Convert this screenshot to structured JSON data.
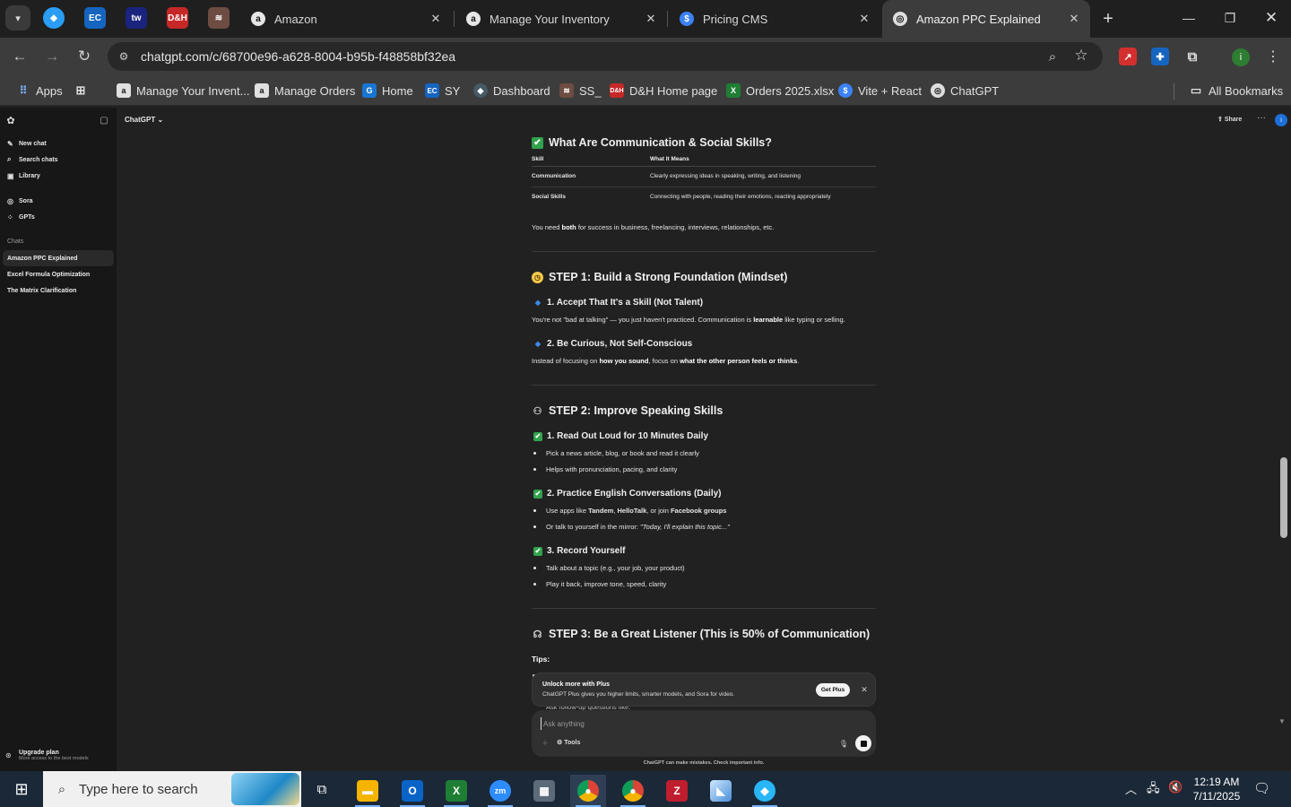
{
  "browser": {
    "tabs": [
      {
        "title": "Amazon",
        "favicon": "a"
      },
      {
        "title": "Manage Your Inventory",
        "favicon": "a"
      },
      {
        "title": "Pricing CMS",
        "favicon": "$"
      },
      {
        "title": "Amazon PPC Explained",
        "favicon": "◎"
      }
    ],
    "url": "chatgpt.com/c/68700e96-a628-8004-b95b-f48858bf32ea",
    "profile_initial": "i",
    "bookmarks": {
      "apps": "Apps",
      "items": [
        "Manage Your Invent...",
        "Manage Orders",
        "Home",
        "SY",
        "Dashboard",
        "SS_",
        "D&H Home page",
        "Orders 2025.xlsx",
        "Vite + React",
        "ChatGPT"
      ],
      "all": "All Bookmarks"
    }
  },
  "sidebar": {
    "new_chat": "New chat",
    "search_chats": "Search chats",
    "library": "Library",
    "sora": "Sora",
    "gpts": "GPTs",
    "chats_label": "Chats",
    "chats": [
      "Amazon PPC Explained",
      "Excel Formula Optimization",
      "The Matrix Clarification"
    ],
    "upgrade_title": "Upgrade plan",
    "upgrade_sub": "More access to the best models"
  },
  "header": {
    "model": "ChatGPT",
    "share": "Share",
    "avatar": "i"
  },
  "content": {
    "h_comm": "What Are Communication & Social Skills?",
    "table": {
      "headers": [
        "Skill",
        "What It Means"
      ],
      "rows": [
        [
          "Communication",
          "Clearly expressing ideas in speaking, writing, and listening"
        ],
        [
          "Social Skills",
          "Connecting with people, reading their emotions, reacting appropriately"
        ]
      ]
    },
    "need_both_pre": "You need ",
    "need_both_bold": "both",
    "need_both_post": " for success in business, freelancing, interviews, relationships, etc.",
    "step1": "STEP 1: Build a Strong Foundation (Mindset)",
    "s1_1": "1. Accept That It's a Skill (Not Talent)",
    "s1_1_pre": "You're not \"bad at talking\" — you just haven't practiced. Communication is ",
    "s1_1_bold": "learnable",
    "s1_1_post": " like typing or selling.",
    "s1_2": "2. Be Curious, Not Self-Conscious",
    "s1_2_pre": "Instead of focusing on ",
    "s1_2_bold1": "how you sound",
    "s1_2_mid": ", focus on ",
    "s1_2_bold2": "what the other person feels or thinks",
    "s1_2_post": ".",
    "step2": "STEP 2: Improve Speaking Skills",
    "s2_1": "1. Read Out Loud for 10 Minutes Daily",
    "s2_1_b1": "Pick a news article, blog, or book and read it clearly",
    "s2_1_b2": "Helps with pronunciation, pacing, and clarity",
    "s2_2": "2. Practice English Conversations (Daily)",
    "s2_2_b1_pre": "Use apps like ",
    "s2_2_b1_bold1": "Tandem",
    "s2_2_b1_sep": ", ",
    "s2_2_b1_bold2": "HelloTalk",
    "s2_2_b1_mid": ", or join ",
    "s2_2_b1_bold3": "Facebook groups",
    "s2_2_b2_pre": "Or talk to yourself in the mirror: ",
    "s2_2_b2_italic": "\"Today, I'll explain this topic...\"",
    "s2_3": "3. Record Yourself",
    "s2_3_b1": "Talk about a topic (e.g., your job, your product)",
    "s2_3_b2": "Play it back, improve tone, speed, clarity",
    "step3": "STEP 3: Be a Great Listener (This is 50% of Communication)",
    "tips": "Tips:",
    "partial_bullet": "Ask follow-up questions like:"
  },
  "upsell": {
    "title": "Unlock more with Plus",
    "sub": "ChatGPT Plus gives you higher limits, smarter models, and Sora for video.",
    "button": "Get Plus"
  },
  "composer": {
    "placeholder": "Ask anything",
    "tools": "Tools",
    "disclaimer": "ChatGPT can make mistakes. Check important info."
  },
  "taskbar": {
    "search_placeholder": "Type here to search",
    "time": "12:19 AM",
    "date": "7/11/2025"
  }
}
